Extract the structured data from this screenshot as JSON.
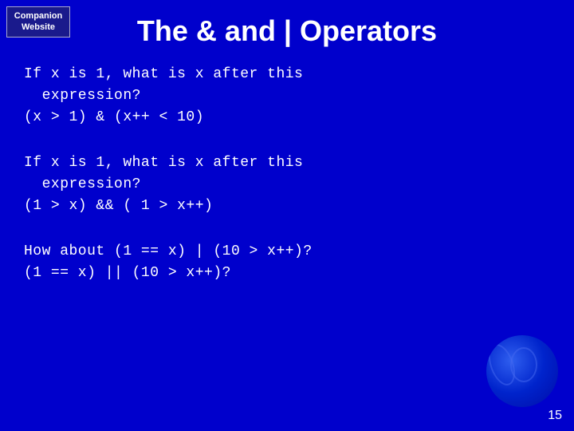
{
  "badge": {
    "line1": "Companion",
    "line2": "Website"
  },
  "header": {
    "title": "The & and | Operators"
  },
  "blocks": [
    {
      "lines": [
        "If x is 1, what is x after this",
        "  expression?",
        "(x > 1) & (x++ < 10)"
      ]
    },
    {
      "lines": [
        "If x is 1, what is x after this",
        "  expression?",
        "(1 > x) && ( 1 > x++)"
      ]
    },
    {
      "lines": [
        "How about (1 == x) | (10 > x++)?",
        "(1 == x) || (10 > x++)?"
      ]
    }
  ],
  "page_number": "15"
}
